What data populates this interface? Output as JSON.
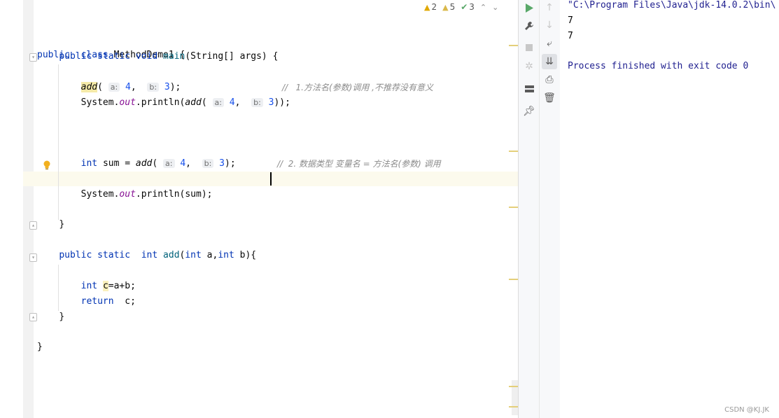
{
  "inspections": {
    "errors": "2",
    "warnings": "5",
    "ok": "3",
    "up_arrow": "⌃",
    "down_arrow": "⌄"
  },
  "code": {
    "l1": {
      "kw1": "public",
      "kw2": "class",
      "name": "MethodDemo1 {"
    },
    "l2": {
      "kw1": "public",
      "kw2": "static",
      "kw3": "void",
      "fn": "main",
      "rest": "(String[] args) {"
    },
    "l3": {
      "fn": "add",
      "hint_a": "a:",
      "val_a": "4",
      "hint_b": "b:",
      "val_b": "3",
      "rest": ");",
      "comment": "//   1.方法名(参数)调用 ,不推荐没有意义"
    },
    "l4": {
      "pre": "System.",
      "field": "out",
      "mid": ".println(",
      "fn": "add",
      "open": "(",
      "hint_a": "a:",
      "val_a": "4",
      "hint_b": "b:",
      "val_b": "3",
      "rest": "));"
    },
    "l5": {
      "kw": "int",
      "pre": "sum = ",
      "fn": "add",
      "open": "(",
      "hint_a": "a:",
      "val_a": "4",
      "hint_b": "b:",
      "val_b": "3",
      "rest": ");",
      "comment": "//  2. 数据类型 变量名 = 方法名(参数) 调用"
    },
    "l6": {
      "pre": "System.",
      "field": "out",
      "rest": ".println(sum);"
    },
    "l7": {
      "text": "}"
    },
    "l8": {
      "kw1": "public",
      "kw2": "static",
      "kw3": "int",
      "fn": "add",
      "p1": "(",
      "kw4": "int",
      "mid": " a,",
      "kw5": "int",
      "rest": " b){"
    },
    "l9": {
      "kw": "int",
      "var": "c",
      "rest": "=a+b;"
    },
    "l10": {
      "kw": "return",
      "rest": "c;"
    },
    "l11": {
      "text": "}"
    },
    "l12": {
      "text": "}"
    }
  },
  "console": {
    "cmd": "\"C:\\Program Files\\Java\\jdk-14.0.2\\bin\\",
    "out1": "7",
    "out2": "7",
    "exit": "Process finished with exit code 0"
  },
  "watermark": "CSDN @KJ.JK",
  "colors": {
    "keyword": "#0033b3",
    "function": "#00627a",
    "number": "#1750eb",
    "comment": "#8c8c8c",
    "console_info": "#1f1f8f",
    "run_green": "#59a869"
  }
}
